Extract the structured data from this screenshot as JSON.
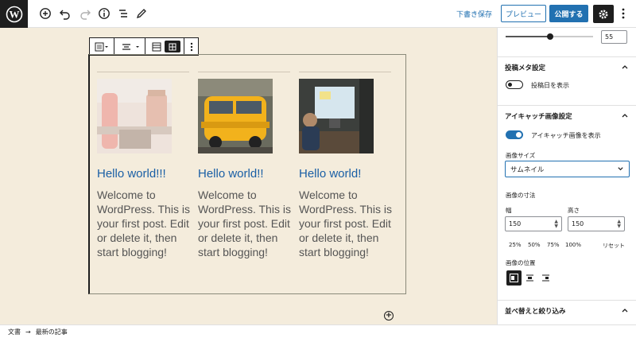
{
  "header": {
    "draft_save": "下書き保存",
    "preview": "プレビュー",
    "publish": "公開する"
  },
  "posts": [
    {
      "title": "Hello world!!!",
      "excerpt": "Welcome to WordPress. This is your first post. Edit or delete it, then start blogging!",
      "image": "cosmetics-bottle-photo"
    },
    {
      "title": "Hello world!!",
      "excerpt": "Welcome to WordPress. This is your first post. Edit or delete it, then start blogging!",
      "image": "yellow-van-photo"
    },
    {
      "title": "Hello world!",
      "excerpt": "Welcome to WordPress. This is your first post. Edit or delete it, then start blogging!",
      "image": "child-at-computer-photo"
    }
  ],
  "sidebar": {
    "slider_value": "55",
    "post_meta": {
      "title": "投稿メタ設定",
      "show_date_label": "投稿日を表示",
      "show_date_on": false
    },
    "featured_image": {
      "title": "アイキャッチ画像設定",
      "show_label": "アイキャッチ画像を表示",
      "show_on": true,
      "size_label": "画像サイズ",
      "size_value": "サムネイル",
      "dimensions_label": "画像の寸法",
      "width_label": "幅",
      "width_value": "150",
      "height_label": "高さ",
      "height_value": "150",
      "presets": [
        "25%",
        "50%",
        "75%",
        "100%"
      ],
      "reset": "リセット",
      "position_label": "画像の位置"
    },
    "sort_filter": {
      "title": "並べ替えと絞り込み"
    }
  },
  "footer": {
    "crumb_root": "文書",
    "arrow": "→",
    "crumb_current": "最新の記事"
  },
  "colors": {
    "accent": "#2271b1",
    "canvas_bg": "#f4ecdc",
    "title_link": "#1a5fa5"
  }
}
